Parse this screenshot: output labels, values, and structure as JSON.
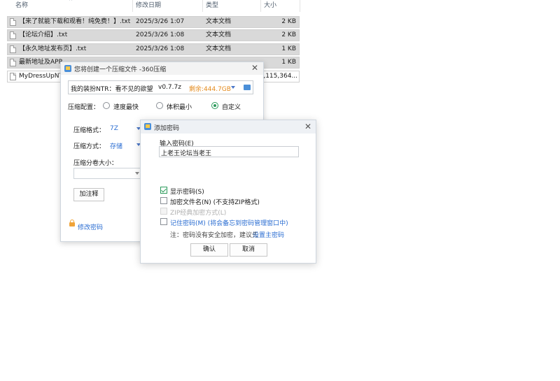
{
  "file_list": {
    "headers": {
      "name": "名称",
      "date": "修改日期",
      "type": "类型",
      "size": "大小"
    },
    "rows": [
      {
        "name": "【来了就能下载和观看！纯免费！】.txt",
        "date": "2025/3/26 1:07",
        "type": "文本文档",
        "size": "2 KB"
      },
      {
        "name": "【论坛介绍】.txt",
        "date": "2025/3/26 1:08",
        "type": "文本文档",
        "size": "2 KB"
      },
      {
        "name": "【永久地址发布页】.txt",
        "date": "2025/3/26 1:08",
        "type": "文本文档",
        "size": "1 KB"
      },
      {
        "name": "最新地址及APP",
        "date": "",
        "type": "",
        "size": "1 KB"
      },
      {
        "name": "MyDressUpNT",
        "date": "",
        "type": "",
        "size": "4,115,364..."
      }
    ]
  },
  "compress_dialog": {
    "title": "您将创建一个压缩文件 -360压缩",
    "path_text": "我的装扮NTR：看不见的欲望",
    "path_suffix": "v0.7.7z",
    "free_space": "剩余:444.7GB",
    "config_label": "压缩配置：",
    "options": [
      "速度最快",
      "体积最小",
      "自定义"
    ],
    "selected_option": "自定义",
    "format_label": "压缩格式：",
    "format_value": "7Z",
    "method_label": "压缩方式：",
    "method_value": "存储",
    "split_label": "压缩分卷大小：",
    "comment_button": "加注释",
    "change_password": "修改密码"
  },
  "password_dialog": {
    "title": "添加密码",
    "input_label": "输入密码(E)",
    "password_value": "上老王论坛当老王",
    "show_password": "显示密码(S)",
    "encrypt_names": "加密文件名(N) (不支持ZIP格式)",
    "zip_classic": "ZIP经典加密方式(L)",
    "remember_password": "记住密码(M) (将会备忘到密码管理窗口中)",
    "note_prefix": "注：密码没有安全加密，建议先",
    "note_link": "设置主密码",
    "ok": "确认",
    "cancel": "取消"
  },
  "colors": {
    "accent_green": "#2b9a5b",
    "link_blue": "#2a6dd2",
    "free_space_orange": "#e48a1c"
  }
}
